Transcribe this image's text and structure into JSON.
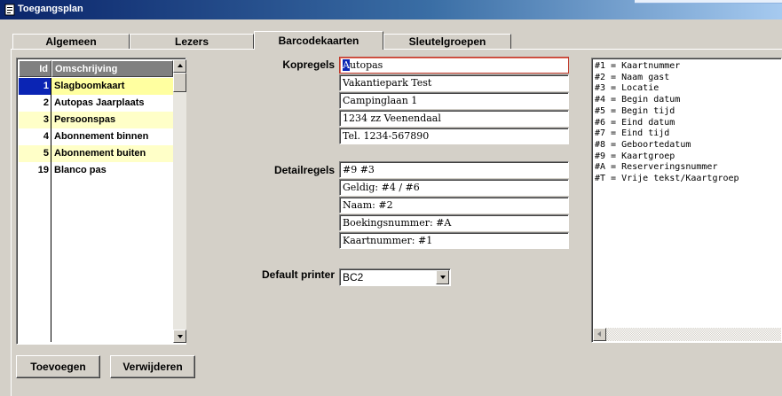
{
  "window": {
    "title": "Toegangsplan"
  },
  "tabs": [
    {
      "label": "Algemeen"
    },
    {
      "label": "Lezers"
    },
    {
      "label": "Barcodekaarten"
    },
    {
      "label": "Sleutelgroepen"
    }
  ],
  "active_tab": "Barcodekaarten",
  "list": {
    "columns": {
      "id": "Id",
      "description": "Omschrijving"
    },
    "rows": [
      {
        "id": "1",
        "description": "Slagboomkaart",
        "selected": true
      },
      {
        "id": "2",
        "description": "Autopas Jaarplaats"
      },
      {
        "id": "3",
        "description": "Persoonspas"
      },
      {
        "id": "4",
        "description": "Abonnement binnen"
      },
      {
        "id": "5",
        "description": "Abonnement buiten"
      },
      {
        "id": "19",
        "description": "Blanco pas"
      }
    ]
  },
  "buttons": {
    "add": "Toevoegen",
    "remove": "Verwijderen"
  },
  "form": {
    "header_label": "Kopregels",
    "header_lines": [
      "Autopas",
      "Vakantiepark Test",
      "Campinglaan 1",
      "1234 zz Veenendaal",
      "Tel. 1234-567890"
    ],
    "header_first_char": "A",
    "header_first_rest": "utopas",
    "detail_label": "Detailregels",
    "detail_lines": [
      "#9 #3",
      "Geldig: #4 / #6",
      "Naam: #2",
      "Boekingsnummer: #A",
      "Kaartnummer: #1"
    ],
    "printer_label": "Default printer",
    "printer_value": "BC2"
  },
  "reference": [
    "#1 = Kaartnummer",
    "#2 = Naam gast",
    "#3 = Locatie",
    "#4 = Begin datum",
    "#5 = Begin tijd",
    "#6 = Eind datum",
    "#7 = Eind tijd",
    "#8 = Geboortedatum",
    "#9 = Kaartgroep",
    "#A = Reserveringsnummer",
    "#T = Vrije tekst/Kaartgroep"
  ],
  "colors": {
    "selected_id": "#0a24b4",
    "row_highlight": "#ffffc8",
    "focus_border": "#c0392b"
  }
}
